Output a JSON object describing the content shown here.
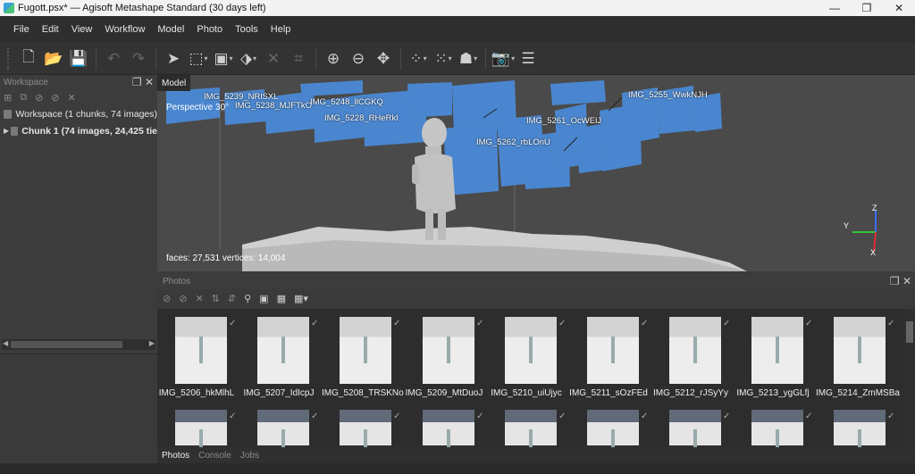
{
  "window": {
    "title": "Fugott.psx* — Agisoft Metashape Standard (30 days left)",
    "minimize": "—",
    "maximize": "❐",
    "close": "✕"
  },
  "menu": [
    "File",
    "Edit",
    "View",
    "Workflow",
    "Model",
    "Photo",
    "Tools",
    "Help"
  ],
  "workspace": {
    "title": "Workspace",
    "root": "Workspace (1 chunks, 74 images)",
    "chunk": "Chunk 1 (74 images, 24,425 tie"
  },
  "model_view": {
    "tab": "Model",
    "projection": "Perspective 30°",
    "stats": "faces: 27,531 vertices: 14,004",
    "axes": {
      "x": "X",
      "y": "Y",
      "z": "Z"
    },
    "camera_labels": [
      "IMG_5239_NRlSXL",
      "IMG_5238_MJFTkO",
      "IMG_5248_llCGKQ",
      "IMG_5228_RHeRkl",
      "IMG_5255_WwkNJH",
      "IMG_5261_OcWElJ",
      "IMG_5262_rbLOnU"
    ],
    "colors": {
      "camera": "#4a86cf",
      "model": "#c8c8c8"
    }
  },
  "photos": {
    "title": "Photos",
    "row1": [
      "IMG_5206_hkMlhL",
      "IMG_5207_IdIcpJ",
      "IMG_5208_TRSKNo",
      "IMG_5209_MtDuoJ",
      "IMG_5210_uiUjyc",
      "IMG_5211_sOzFEd",
      "IMG_5212_rJSyYy",
      "IMG_5213_ygGLfj",
      "IMG_5214_ZmMSBa"
    ],
    "row2_count": 9
  },
  "bottom_tabs": [
    "Photos",
    "Console",
    "Jobs"
  ]
}
